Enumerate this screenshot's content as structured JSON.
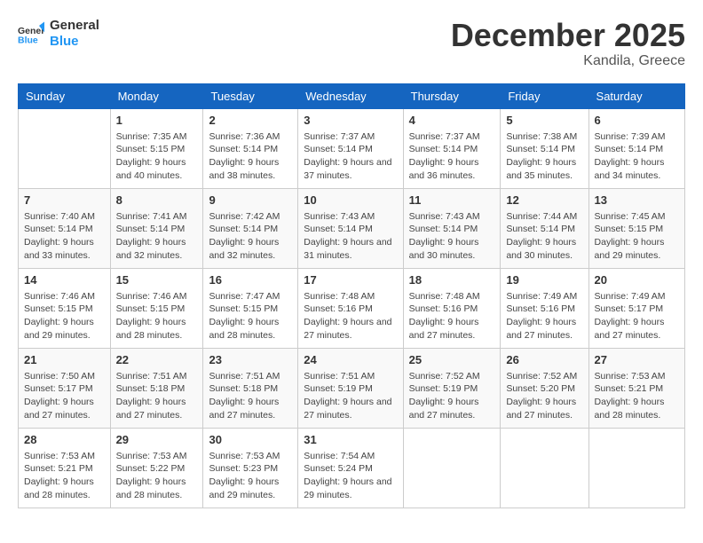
{
  "header": {
    "logo_line1": "General",
    "logo_line2": "Blue",
    "month": "December 2025",
    "location": "Kandila, Greece"
  },
  "weekdays": [
    "Sunday",
    "Monday",
    "Tuesday",
    "Wednesday",
    "Thursday",
    "Friday",
    "Saturday"
  ],
  "weeks": [
    [
      {
        "day": "",
        "sunrise": "",
        "sunset": "",
        "daylight": ""
      },
      {
        "day": "1",
        "sunrise": "Sunrise: 7:35 AM",
        "sunset": "Sunset: 5:15 PM",
        "daylight": "Daylight: 9 hours and 40 minutes."
      },
      {
        "day": "2",
        "sunrise": "Sunrise: 7:36 AM",
        "sunset": "Sunset: 5:14 PM",
        "daylight": "Daylight: 9 hours and 38 minutes."
      },
      {
        "day": "3",
        "sunrise": "Sunrise: 7:37 AM",
        "sunset": "Sunset: 5:14 PM",
        "daylight": "Daylight: 9 hours and 37 minutes."
      },
      {
        "day": "4",
        "sunrise": "Sunrise: 7:37 AM",
        "sunset": "Sunset: 5:14 PM",
        "daylight": "Daylight: 9 hours and 36 minutes."
      },
      {
        "day": "5",
        "sunrise": "Sunrise: 7:38 AM",
        "sunset": "Sunset: 5:14 PM",
        "daylight": "Daylight: 9 hours and 35 minutes."
      },
      {
        "day": "6",
        "sunrise": "Sunrise: 7:39 AM",
        "sunset": "Sunset: 5:14 PM",
        "daylight": "Daylight: 9 hours and 34 minutes."
      }
    ],
    [
      {
        "day": "7",
        "sunrise": "Sunrise: 7:40 AM",
        "sunset": "Sunset: 5:14 PM",
        "daylight": "Daylight: 9 hours and 33 minutes."
      },
      {
        "day": "8",
        "sunrise": "Sunrise: 7:41 AM",
        "sunset": "Sunset: 5:14 PM",
        "daylight": "Daylight: 9 hours and 32 minutes."
      },
      {
        "day": "9",
        "sunrise": "Sunrise: 7:42 AM",
        "sunset": "Sunset: 5:14 PM",
        "daylight": "Daylight: 9 hours and 32 minutes."
      },
      {
        "day": "10",
        "sunrise": "Sunrise: 7:43 AM",
        "sunset": "Sunset: 5:14 PM",
        "daylight": "Daylight: 9 hours and 31 minutes."
      },
      {
        "day": "11",
        "sunrise": "Sunrise: 7:43 AM",
        "sunset": "Sunset: 5:14 PM",
        "daylight": "Daylight: 9 hours and 30 minutes."
      },
      {
        "day": "12",
        "sunrise": "Sunrise: 7:44 AM",
        "sunset": "Sunset: 5:14 PM",
        "daylight": "Daylight: 9 hours and 30 minutes."
      },
      {
        "day": "13",
        "sunrise": "Sunrise: 7:45 AM",
        "sunset": "Sunset: 5:15 PM",
        "daylight": "Daylight: 9 hours and 29 minutes."
      }
    ],
    [
      {
        "day": "14",
        "sunrise": "Sunrise: 7:46 AM",
        "sunset": "Sunset: 5:15 PM",
        "daylight": "Daylight: 9 hours and 29 minutes."
      },
      {
        "day": "15",
        "sunrise": "Sunrise: 7:46 AM",
        "sunset": "Sunset: 5:15 PM",
        "daylight": "Daylight: 9 hours and 28 minutes."
      },
      {
        "day": "16",
        "sunrise": "Sunrise: 7:47 AM",
        "sunset": "Sunset: 5:15 PM",
        "daylight": "Daylight: 9 hours and 28 minutes."
      },
      {
        "day": "17",
        "sunrise": "Sunrise: 7:48 AM",
        "sunset": "Sunset: 5:16 PM",
        "daylight": "Daylight: 9 hours and 27 minutes."
      },
      {
        "day": "18",
        "sunrise": "Sunrise: 7:48 AM",
        "sunset": "Sunset: 5:16 PM",
        "daylight": "Daylight: 9 hours and 27 minutes."
      },
      {
        "day": "19",
        "sunrise": "Sunrise: 7:49 AM",
        "sunset": "Sunset: 5:16 PM",
        "daylight": "Daylight: 9 hours and 27 minutes."
      },
      {
        "day": "20",
        "sunrise": "Sunrise: 7:49 AM",
        "sunset": "Sunset: 5:17 PM",
        "daylight": "Daylight: 9 hours and 27 minutes."
      }
    ],
    [
      {
        "day": "21",
        "sunrise": "Sunrise: 7:50 AM",
        "sunset": "Sunset: 5:17 PM",
        "daylight": "Daylight: 9 hours and 27 minutes."
      },
      {
        "day": "22",
        "sunrise": "Sunrise: 7:51 AM",
        "sunset": "Sunset: 5:18 PM",
        "daylight": "Daylight: 9 hours and 27 minutes."
      },
      {
        "day": "23",
        "sunrise": "Sunrise: 7:51 AM",
        "sunset": "Sunset: 5:18 PM",
        "daylight": "Daylight: 9 hours and 27 minutes."
      },
      {
        "day": "24",
        "sunrise": "Sunrise: 7:51 AM",
        "sunset": "Sunset: 5:19 PM",
        "daylight": "Daylight: 9 hours and 27 minutes."
      },
      {
        "day": "25",
        "sunrise": "Sunrise: 7:52 AM",
        "sunset": "Sunset: 5:19 PM",
        "daylight": "Daylight: 9 hours and 27 minutes."
      },
      {
        "day": "26",
        "sunrise": "Sunrise: 7:52 AM",
        "sunset": "Sunset: 5:20 PM",
        "daylight": "Daylight: 9 hours and 27 minutes."
      },
      {
        "day": "27",
        "sunrise": "Sunrise: 7:53 AM",
        "sunset": "Sunset: 5:21 PM",
        "daylight": "Daylight: 9 hours and 28 minutes."
      }
    ],
    [
      {
        "day": "28",
        "sunrise": "Sunrise: 7:53 AM",
        "sunset": "Sunset: 5:21 PM",
        "daylight": "Daylight: 9 hours and 28 minutes."
      },
      {
        "day": "29",
        "sunrise": "Sunrise: 7:53 AM",
        "sunset": "Sunset: 5:22 PM",
        "daylight": "Daylight: 9 hours and 28 minutes."
      },
      {
        "day": "30",
        "sunrise": "Sunrise: 7:53 AM",
        "sunset": "Sunset: 5:23 PM",
        "daylight": "Daylight: 9 hours and 29 minutes."
      },
      {
        "day": "31",
        "sunrise": "Sunrise: 7:54 AM",
        "sunset": "Sunset: 5:24 PM",
        "daylight": "Daylight: 9 hours and 29 minutes."
      },
      {
        "day": "",
        "sunrise": "",
        "sunset": "",
        "daylight": ""
      },
      {
        "day": "",
        "sunrise": "",
        "sunset": "",
        "daylight": ""
      },
      {
        "day": "",
        "sunrise": "",
        "sunset": "",
        "daylight": ""
      }
    ]
  ]
}
